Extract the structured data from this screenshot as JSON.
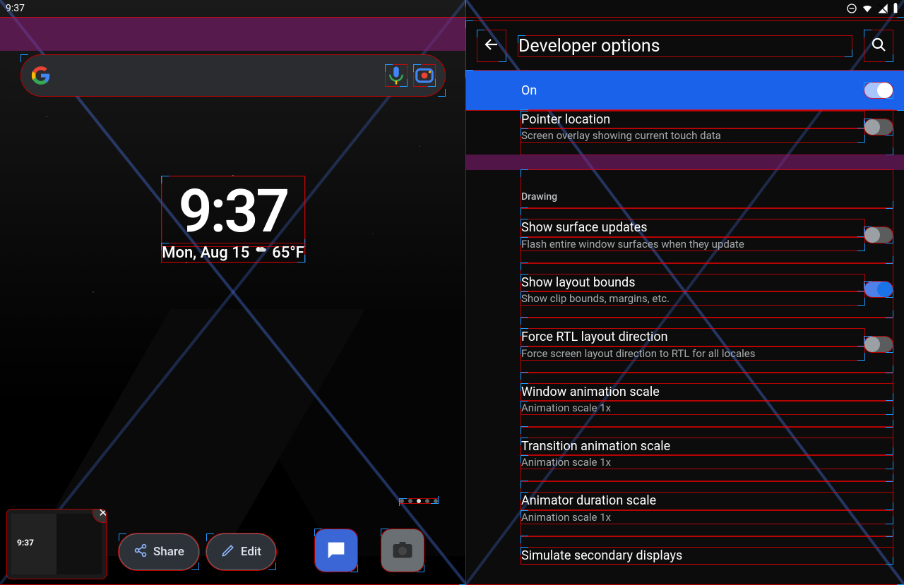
{
  "status": {
    "time": "9:37"
  },
  "home": {
    "clock_time": "9:37",
    "clock_date": "Mon, Aug 15",
    "clock_weather": "65°F",
    "share_label": "Share",
    "edit_label": "Edit",
    "thumb_time": "9:37",
    "search_placeholder": ""
  },
  "settings": {
    "title": "Developer options",
    "master_label": "On",
    "items": [
      {
        "title": "Pointer location",
        "sub": "Screen overlay showing current touch data",
        "switch": "off"
      },
      {
        "section": "Drawing"
      },
      {
        "title": "Show surface updates",
        "sub": "Flash entire window surfaces when they update",
        "switch": "off"
      },
      {
        "title": "Show layout bounds",
        "sub": "Show clip bounds, margins, etc.",
        "switch": "on"
      },
      {
        "title": "Force RTL layout direction",
        "sub": "Force screen layout direction to RTL for all locales",
        "switch": "off"
      },
      {
        "title": "Window animation scale",
        "sub": "Animation scale 1x"
      },
      {
        "title": "Transition animation scale",
        "sub": "Animation scale 1x"
      },
      {
        "title": "Animator duration scale",
        "sub": "Animation scale 1x"
      },
      {
        "title": "Simulate secondary displays",
        "sub": ""
      }
    ]
  }
}
